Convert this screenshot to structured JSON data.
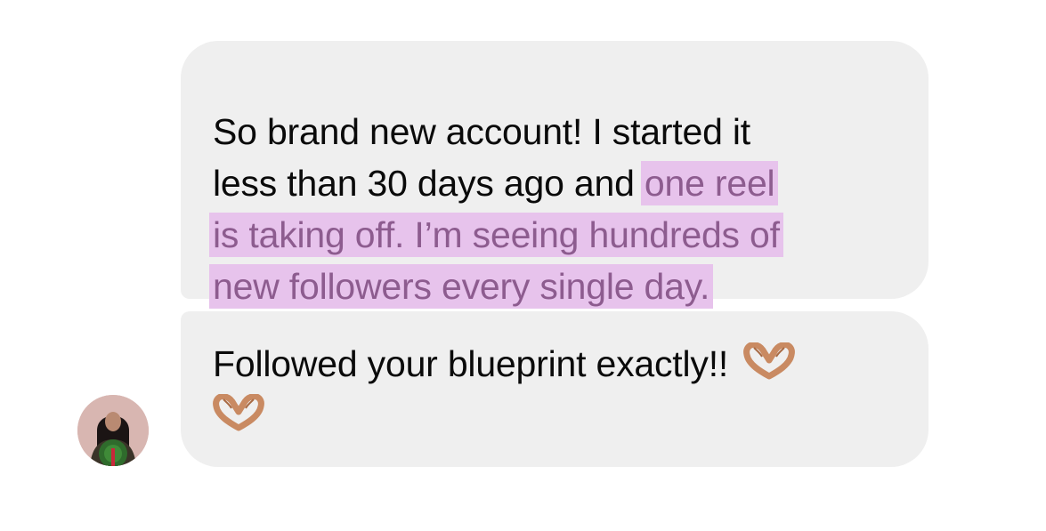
{
  "messages": [
    {
      "lines": [
        {
          "plain": "So brand new account! I started it",
          "highlight": ""
        },
        {
          "plain": "less than 30 days ago and ",
          "highlight": "one reel"
        },
        {
          "plain": "",
          "highlight": "is taking off. I’m seeing hundreds of"
        },
        {
          "plain": "",
          "highlight": "new followers every single day."
        }
      ]
    },
    {
      "text": "Followed your blueprint exactly!!",
      "emoji": [
        "heart-hands-icon",
        "heart-hands-icon"
      ]
    }
  ],
  "colors": {
    "bubble": "#efefef",
    "highlight_bg": "#e7c3ec",
    "highlight_text": "#8d5c8f",
    "text": "#0a0a0a"
  }
}
